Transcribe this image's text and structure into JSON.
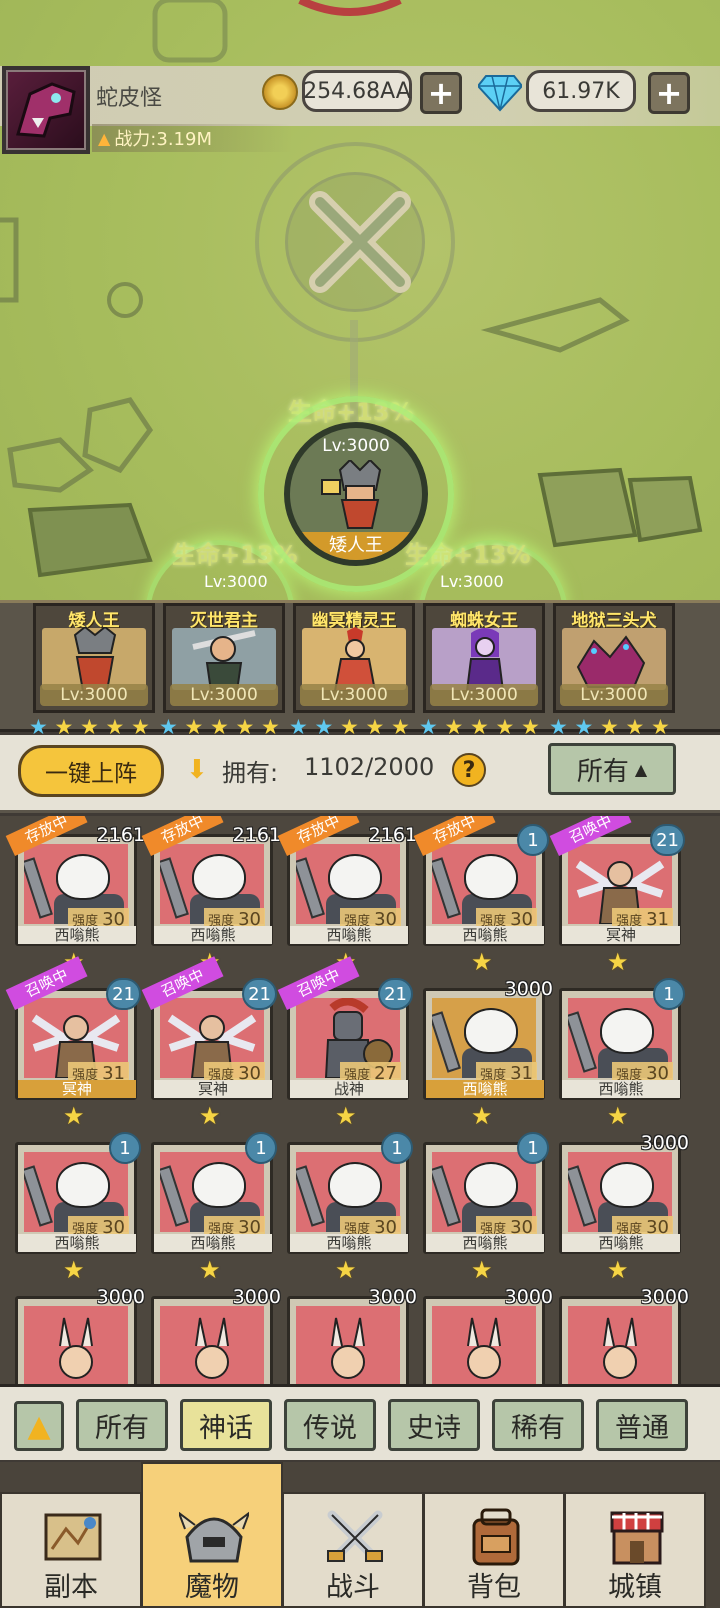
{
  "player": {
    "name": "蛇皮怪",
    "power": "战力:3.19M",
    "gold": "254.68AA",
    "gems": "61.97K"
  },
  "hero": {
    "level": "Lv:3000",
    "name": "矮人王",
    "bonus": "生命+13%"
  },
  "team": [
    {
      "name": "矮人王",
      "level": "Lv:3000"
    },
    {
      "name": "灭世君主",
      "level": "Lv:3000"
    },
    {
      "name": "幽冥精灵王",
      "level": "Lv:3000"
    },
    {
      "name": "蜘蛛女王",
      "level": "Lv:3000"
    },
    {
      "name": "地狱三头犬",
      "level": "Lv:3000"
    }
  ],
  "team_stars_blue": [
    1,
    1,
    2,
    1,
    2
  ],
  "ghost_levels": [
    "Lv:3000",
    "Lv:3000"
  ],
  "owned": {
    "deploy_label": "一键上阵",
    "label": "拥有:",
    "count": "1102/2000",
    "help": "?",
    "filter": "所有"
  },
  "strength_label": "强度",
  "grid": [
    {
      "name": "西嗡熊",
      "strength": "30",
      "count": "2161",
      "tag": "存放中",
      "tagType": "store",
      "type": "panda"
    },
    {
      "name": "西嗡熊",
      "strength": "30",
      "count": "2161",
      "tag": "存放中",
      "tagType": "store",
      "type": "panda"
    },
    {
      "name": "西嗡熊",
      "strength": "30",
      "count": "2161",
      "tag": "存放中",
      "tagType": "store",
      "type": "panda"
    },
    {
      "name": "西嗡熊",
      "strength": "30",
      "count": "1",
      "tag": "存放中",
      "tagType": "store",
      "type": "panda"
    },
    {
      "name": "冥神",
      "strength": "31",
      "count": "21",
      "tag": "召唤中",
      "tagType": "summon",
      "type": "angel"
    },
    {
      "name": "冥神",
      "strength": "31",
      "count": "21",
      "tag": "召唤中",
      "tagType": "summon",
      "type": "angel",
      "hl": true
    },
    {
      "name": "冥神",
      "strength": "30",
      "count": "21",
      "tag": "召唤中",
      "tagType": "summon",
      "type": "angel"
    },
    {
      "name": "战神",
      "strength": "27",
      "count": "21",
      "tag": "召唤中",
      "tagType": "summon",
      "type": "knight"
    },
    {
      "name": "西嗡熊",
      "strength": "31",
      "count": "3000",
      "tag": "",
      "type": "panda",
      "gold": true,
      "hl": true
    },
    {
      "name": "西嗡熊",
      "strength": "30",
      "count": "1",
      "tag": "",
      "type": "panda"
    },
    {
      "name": "西嗡熊",
      "strength": "30",
      "count": "1",
      "tag": "",
      "type": "panda"
    },
    {
      "name": "西嗡熊",
      "strength": "30",
      "count": "1",
      "tag": "",
      "type": "panda"
    },
    {
      "name": "西嗡熊",
      "strength": "30",
      "count": "1",
      "tag": "",
      "type": "panda"
    },
    {
      "name": "西嗡熊",
      "strength": "30",
      "count": "1",
      "tag": "",
      "type": "panda"
    },
    {
      "name": "西嗡熊",
      "strength": "30",
      "count": "3000",
      "tag": "",
      "type": "panda"
    },
    {
      "name": "",
      "strength": "",
      "count": "3000",
      "tag": "",
      "type": "bunny"
    },
    {
      "name": "",
      "strength": "",
      "count": "3000",
      "tag": "",
      "type": "bunny"
    },
    {
      "name": "",
      "strength": "",
      "count": "3000",
      "tag": "",
      "type": "bunny"
    },
    {
      "name": "",
      "strength": "",
      "count": "3000",
      "tag": "",
      "type": "bunny"
    },
    {
      "name": "",
      "strength": "",
      "count": "3000",
      "tag": "",
      "type": "bunny"
    }
  ],
  "rarity_tabs": [
    "所有",
    "神话",
    "传说",
    "史诗",
    "稀有",
    "普通"
  ],
  "active_rarity": 1,
  "nav": [
    {
      "label": "副本",
      "icon": "map-icon"
    },
    {
      "label": "魔物",
      "icon": "helmet-icon"
    },
    {
      "label": "战斗",
      "icon": "crossed-swords-icon"
    },
    {
      "label": "背包",
      "icon": "backpack-icon"
    },
    {
      "label": "城镇",
      "icon": "house-icon"
    }
  ],
  "active_nav": 1,
  "colors": {
    "accent_gold": "#f5c53c",
    "star_blue": "#5fc8f0",
    "star_gold": "#f6d545",
    "tag_store": "#f08a2a",
    "tag_summon": "#d04ce0"
  }
}
